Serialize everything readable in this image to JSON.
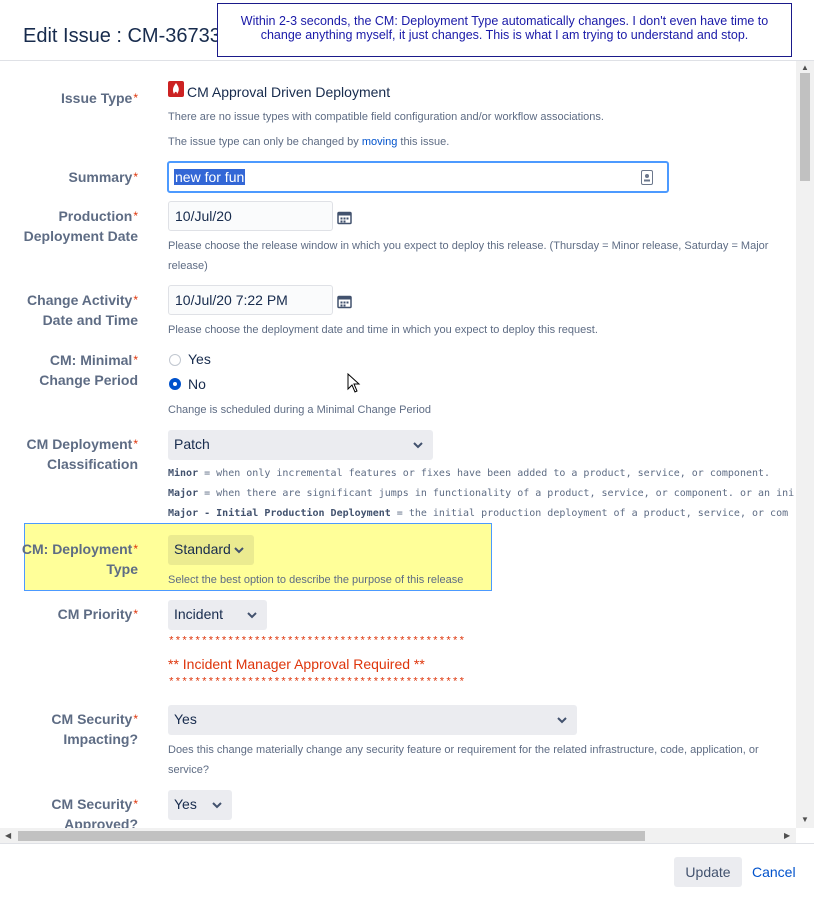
{
  "dialog": {
    "title": "Edit Issue : CM-36733"
  },
  "callout": {
    "text": "Within 2-3 seconds, the CM: Deployment Type automatically changes.  I don't even have time to change anything myself, it just changes.  This is what I am trying to understand and stop."
  },
  "issue_type": {
    "label": "Issue Type",
    "value": "CM Approval Driven Deployment",
    "note1": "There are no issue types with compatible field configuration and/or workflow associations.",
    "note2_pre": "The issue type can only be changed by ",
    "note2_link": "moving",
    "note2_post": " this issue."
  },
  "summary": {
    "label": "Summary",
    "value": "new for fun"
  },
  "production_date": {
    "label_line1": "Production",
    "label_line2": "Deployment Date",
    "value": "10/Jul/20",
    "help_line1": "Please choose the release window in which you expect to deploy this release. (Thursday = Minor release, Saturday = Major",
    "help_line2": "release)"
  },
  "change_activity": {
    "label_line1": "Change Activity",
    "label_line2": "Date and Time",
    "value": "10/Jul/20 7:22 PM",
    "help": "Please choose the deployment date and time in which you expect to deploy this request."
  },
  "minimal_change": {
    "label_line1": "CM: Minimal",
    "label_line2": "Change Period",
    "option_yes": "Yes",
    "option_no": "No",
    "selected": "No",
    "help": "Change is scheduled during a Minimal Change Period"
  },
  "deployment_classification": {
    "label_line1": "CM Deployment",
    "label_line2": "Classification",
    "value": "Patch",
    "minor_term": "Minor",
    "minor_desc": "  = when only incremental features or fixes have been added to a product, service, or component.",
    "major_term": "Major",
    "major_desc": " = when there are significant jumps in functionality of a product, service, or component. or an ini",
    "initial_term": "Major - Initial Production Deployment",
    "initial_desc": "  = the initial production deployment of a product, service, or com"
  },
  "deployment_type": {
    "label_line1": "CM: Deployment",
    "label_line2": "Type",
    "value": "Standard",
    "help": "Select the best option to describe the purpose of this release"
  },
  "priority": {
    "label": "CM Priority",
    "value": "Incident",
    "stars": "*********************************************",
    "message": "** Incident Manager Approval Required **"
  },
  "security_impacting": {
    "label_line1": "CM Security",
    "label_line2": "Impacting?",
    "value": "Yes",
    "help_line1": "Does this change materially change any security feature or requirement for the related infrastructure, code, application, or",
    "help_line2": "service?"
  },
  "security_approved": {
    "label_line1": "CM Security",
    "label_line2": "Approved?",
    "value": "Yes"
  },
  "footer": {
    "update_label": "Update",
    "cancel_label": "Cancel"
  },
  "colors": {
    "required": "#de350b",
    "link": "#0052cc",
    "highlight": "#ffff99",
    "callout_text": "#1a1aa8"
  }
}
